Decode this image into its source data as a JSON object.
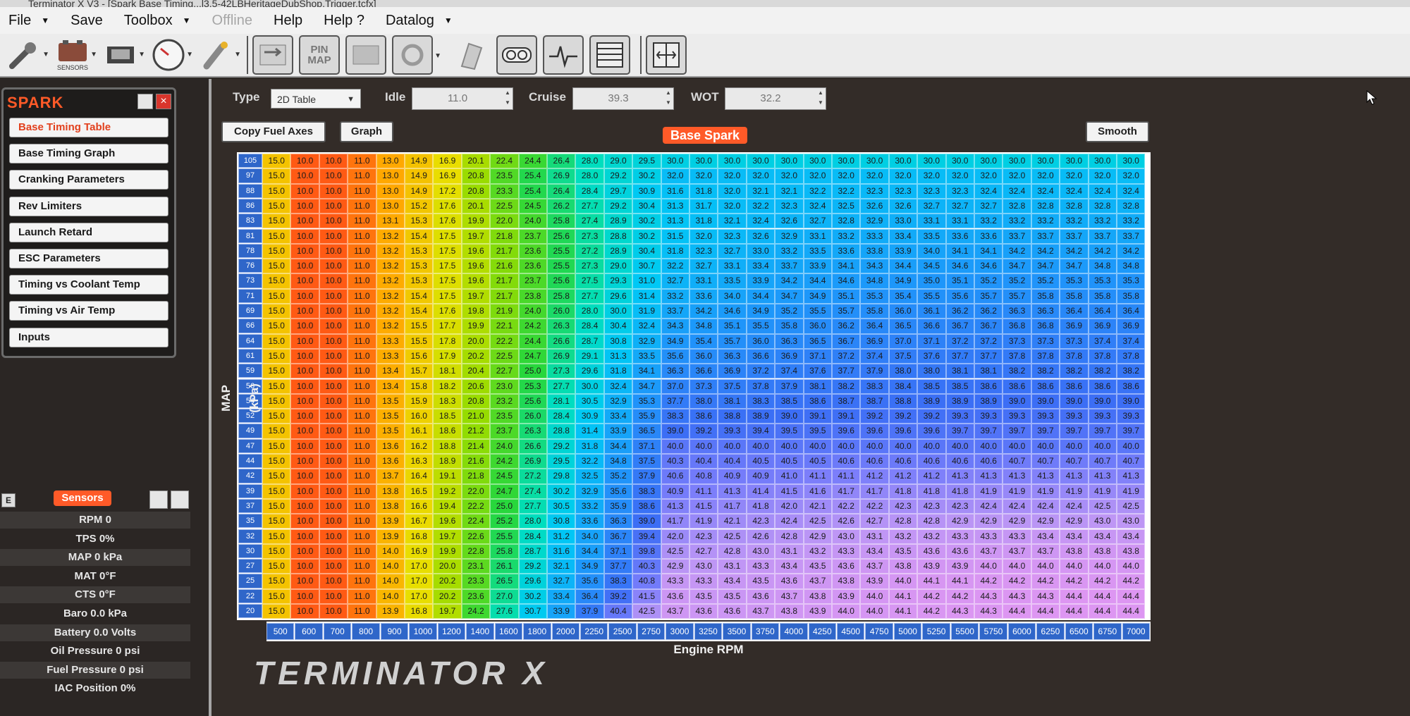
{
  "window": {
    "title": "Terminator X V3 - [Spark Base Timing...l3.5-42LBHeritageDubShop.Trigger.tcfx]"
  },
  "menu": [
    {
      "label": "File",
      "caret": true,
      "disabled": false
    },
    {
      "label": "Save",
      "caret": false,
      "disabled": false
    },
    {
      "label": "Toolbox",
      "caret": true,
      "disabled": false
    },
    {
      "label": "Offline",
      "caret": false,
      "disabled": true
    },
    {
      "label": "Help",
      "caret": false,
      "disabled": false
    },
    {
      "label": "Help ?",
      "caret": false,
      "disabled": false
    },
    {
      "label": "Datalog",
      "caret": true,
      "disabled": false
    }
  ],
  "toolbar": {
    "sensors_label": "SENSORS",
    "pinmap_line1": "PIN",
    "pinmap_line2": "MAP"
  },
  "spark_panel": {
    "title": "SPARK",
    "close_glyph": "×",
    "items": [
      {
        "label": "Base Timing Table",
        "active": true
      },
      {
        "label": "Base Timing Graph",
        "active": false
      },
      {
        "label": "Cranking Parameters",
        "active": false
      },
      {
        "label": "Rev Limiters",
        "active": false
      },
      {
        "label": "Launch Retard",
        "active": false
      },
      {
        "label": "ESC Parameters",
        "active": false
      },
      {
        "label": "Timing vs Coolant Temp",
        "active": false
      },
      {
        "label": "Timing vs Air Temp",
        "active": false
      },
      {
        "label": "Inputs",
        "active": false
      }
    ]
  },
  "sensors": {
    "e_label": "E",
    "title": "Sensors",
    "rows": [
      "RPM 0",
      "TPS 0%",
      "MAP 0 kPa",
      "MAT 0°F",
      "CTS 0°F",
      "Baro 0.0 kPa",
      "Battery 0.0 Volts",
      "Oil Pressure 0 psi",
      "Fuel Pressure 0 psi",
      "IAC Position 0%"
    ]
  },
  "controls": {
    "type_label": "Type",
    "type_value": "2D Table",
    "idle_label": "Idle",
    "idle_value": "11.0",
    "cruise_label": "Cruise",
    "cruise_value": "39.3",
    "wot_label": "WOT",
    "wot_value": "32.2",
    "copy_fuel_axes": "Copy Fuel Axes",
    "graph": "Graph",
    "smooth": "Smooth",
    "table_title": "Base Spark"
  },
  "axes": {
    "x_title": "Engine RPM",
    "y_title": "MAP (kPa)"
  },
  "logo_text": "TERMINATOR X",
  "colors": {
    "accent": "#ff5a28",
    "axis_cell": "#2f66c9"
  },
  "table": {
    "rpm": [
      500,
      600,
      700,
      800,
      900,
      1000,
      1200,
      1400,
      1600,
      1800,
      2000,
      2250,
      2500,
      2750,
      3000,
      3250,
      3500,
      3750,
      4000,
      4250,
      4500,
      4750,
      5000,
      5250,
      5500,
      5750,
      6000,
      6250,
      6500,
      6750,
      7000
    ],
    "map": [
      105,
      97,
      88,
      86,
      83,
      81,
      78,
      76,
      73,
      71,
      69,
      66,
      64,
      61,
      59,
      56,
      54,
      52,
      49,
      47,
      44,
      42,
      39,
      37,
      35,
      32,
      30,
      27,
      25,
      22,
      20
    ],
    "rows": [
      [
        "15.0",
        "10.0",
        "10.0",
        "11.0",
        "13.0",
        "14.9",
        "16.9",
        "20.1",
        "22.4",
        "24.4",
        "26.4",
        "28.0",
        "29.0",
        "29.5",
        "30.0",
        "30.0",
        "30.0",
        "30.0",
        "30.0",
        "30.0",
        "30.0",
        "30.0",
        "30.0",
        "30.0",
        "30.0",
        "30.0",
        "30.0",
        "30.0",
        "30.0",
        "30.0",
        "30.0"
      ],
      [
        "15.0",
        "10.0",
        "10.0",
        "11.0",
        "13.0",
        "14.9",
        "16.9",
        "20.8",
        "23.5",
        "25.4",
        "26.9",
        "28.0",
        "29.2",
        "30.2",
        "32.0",
        "32.0",
        "32.0",
        "32.0",
        "32.0",
        "32.0",
        "32.0",
        "32.0",
        "32.0",
        "32.0",
        "32.0",
        "32.0",
        "32.0",
        "32.0",
        "32.0",
        "32.0",
        "32.0"
      ],
      [
        "15.0",
        "10.0",
        "10.0",
        "11.0",
        "13.0",
        "14.9",
        "17.2",
        "20.8",
        "23.3",
        "25.4",
        "26.4",
        "28.4",
        "29.7",
        "30.9",
        "31.6",
        "31.8",
        "32.0",
        "32.1",
        "32.1",
        "32.2",
        "32.2",
        "32.3",
        "32.3",
        "32.3",
        "32.3",
        "32.4",
        "32.4",
        "32.4",
        "32.4",
        "32.4",
        "32.4"
      ],
      [
        "15.0",
        "10.0",
        "10.0",
        "11.0",
        "13.0",
        "15.2",
        "17.6",
        "20.1",
        "22.5",
        "24.5",
        "26.2",
        "27.7",
        "29.2",
        "30.4",
        "31.3",
        "31.7",
        "32.0",
        "32.2",
        "32.3",
        "32.4",
        "32.5",
        "32.6",
        "32.6",
        "32.7",
        "32.7",
        "32.7",
        "32.8",
        "32.8",
        "32.8",
        "32.8",
        "32.8"
      ],
      [
        "15.0",
        "10.0",
        "10.0",
        "11.0",
        "13.1",
        "15.3",
        "17.6",
        "19.9",
        "22.0",
        "24.0",
        "25.8",
        "27.4",
        "28.9",
        "30.2",
        "31.3",
        "31.8",
        "32.1",
        "32.4",
        "32.6",
        "32.7",
        "32.8",
        "32.9",
        "33.0",
        "33.1",
        "33.1",
        "33.2",
        "33.2",
        "33.2",
        "33.2",
        "33.2",
        "33.2"
      ],
      [
        "15.0",
        "10.0",
        "10.0",
        "11.0",
        "13.2",
        "15.4",
        "17.5",
        "19.7",
        "21.8",
        "23.7",
        "25.6",
        "27.3",
        "28.8",
        "30.2",
        "31.5",
        "32.0",
        "32.3",
        "32.6",
        "32.9",
        "33.1",
        "33.2",
        "33.3",
        "33.4",
        "33.5",
        "33.6",
        "33.6",
        "33.7",
        "33.7",
        "33.7",
        "33.7",
        "33.7"
      ],
      [
        "15.0",
        "10.0",
        "10.0",
        "11.0",
        "13.2",
        "15.3",
        "17.5",
        "19.6",
        "21.7",
        "23.6",
        "25.5",
        "27.2",
        "28.9",
        "30.4",
        "31.8",
        "32.3",
        "32.7",
        "33.0",
        "33.2",
        "33.5",
        "33.6",
        "33.8",
        "33.9",
        "34.0",
        "34.1",
        "34.1",
        "34.2",
        "34.2",
        "34.2",
        "34.2",
        "34.2"
      ],
      [
        "15.0",
        "10.0",
        "10.0",
        "11.0",
        "13.2",
        "15.3",
        "17.5",
        "19.6",
        "21.6",
        "23.6",
        "25.5",
        "27.3",
        "29.0",
        "30.7",
        "32.2",
        "32.7",
        "33.1",
        "33.4",
        "33.7",
        "33.9",
        "34.1",
        "34.3",
        "34.4",
        "34.5",
        "34.6",
        "34.6",
        "34.7",
        "34.7",
        "34.7",
        "34.8",
        "34.8"
      ],
      [
        "15.0",
        "10.0",
        "10.0",
        "11.0",
        "13.2",
        "15.3",
        "17.5",
        "19.6",
        "21.7",
        "23.7",
        "25.6",
        "27.5",
        "29.3",
        "31.0",
        "32.7",
        "33.1",
        "33.5",
        "33.9",
        "34.2",
        "34.4",
        "34.6",
        "34.8",
        "34.9",
        "35.0",
        "35.1",
        "35.2",
        "35.2",
        "35.2",
        "35.3",
        "35.3",
        "35.3"
      ],
      [
        "15.0",
        "10.0",
        "10.0",
        "11.0",
        "13.2",
        "15.4",
        "17.5",
        "19.7",
        "21.7",
        "23.8",
        "25.8",
        "27.7",
        "29.6",
        "31.4",
        "33.2",
        "33.6",
        "34.0",
        "34.4",
        "34.7",
        "34.9",
        "35.1",
        "35.3",
        "35.4",
        "35.5",
        "35.6",
        "35.7",
        "35.7",
        "35.8",
        "35.8",
        "35.8",
        "35.8"
      ],
      [
        "15.0",
        "10.0",
        "10.0",
        "11.0",
        "13.2",
        "15.4",
        "17.6",
        "19.8",
        "21.9",
        "24.0",
        "26.0",
        "28.0",
        "30.0",
        "31.9",
        "33.7",
        "34.2",
        "34.6",
        "34.9",
        "35.2",
        "35.5",
        "35.7",
        "35.8",
        "36.0",
        "36.1",
        "36.2",
        "36.2",
        "36.3",
        "36.3",
        "36.4",
        "36.4",
        "36.4"
      ],
      [
        "15.0",
        "10.0",
        "10.0",
        "11.0",
        "13.2",
        "15.5",
        "17.7",
        "19.9",
        "22.1",
        "24.2",
        "26.3",
        "28.4",
        "30.4",
        "32.4",
        "34.3",
        "34.8",
        "35.1",
        "35.5",
        "35.8",
        "36.0",
        "36.2",
        "36.4",
        "36.5",
        "36.6",
        "36.7",
        "36.7",
        "36.8",
        "36.8",
        "36.9",
        "36.9",
        "36.9"
      ],
      [
        "15.0",
        "10.0",
        "10.0",
        "11.0",
        "13.3",
        "15.5",
        "17.8",
        "20.0",
        "22.2",
        "24.4",
        "26.6",
        "28.7",
        "30.8",
        "32.9",
        "34.9",
        "35.4",
        "35.7",
        "36.0",
        "36.3",
        "36.5",
        "36.7",
        "36.9",
        "37.0",
        "37.1",
        "37.2",
        "37.2",
        "37.3",
        "37.3",
        "37.3",
        "37.4",
        "37.4"
      ],
      [
        "15.0",
        "10.0",
        "10.0",
        "11.0",
        "13.3",
        "15.6",
        "17.9",
        "20.2",
        "22.5",
        "24.7",
        "26.9",
        "29.1",
        "31.3",
        "33.5",
        "35.6",
        "36.0",
        "36.3",
        "36.6",
        "36.9",
        "37.1",
        "37.2",
        "37.4",
        "37.5",
        "37.6",
        "37.7",
        "37.7",
        "37.8",
        "37.8",
        "37.8",
        "37.8",
        "37.8"
      ],
      [
        "15.0",
        "10.0",
        "10.0",
        "11.0",
        "13.4",
        "15.7",
        "18.1",
        "20.4",
        "22.7",
        "25.0",
        "27.3",
        "29.6",
        "31.8",
        "34.1",
        "36.3",
        "36.6",
        "36.9",
        "37.2",
        "37.4",
        "37.6",
        "37.7",
        "37.9",
        "38.0",
        "38.0",
        "38.1",
        "38.1",
        "38.2",
        "38.2",
        "38.2",
        "38.2",
        "38.2"
      ],
      [
        "15.0",
        "10.0",
        "10.0",
        "11.0",
        "13.4",
        "15.8",
        "18.2",
        "20.6",
        "23.0",
        "25.3",
        "27.7",
        "30.0",
        "32.4",
        "34.7",
        "37.0",
        "37.3",
        "37.5",
        "37.8",
        "37.9",
        "38.1",
        "38.2",
        "38.3",
        "38.4",
        "38.5",
        "38.5",
        "38.6",
        "38.6",
        "38.6",
        "38.6",
        "38.6",
        "38.6"
      ],
      [
        "15.0",
        "10.0",
        "10.0",
        "11.0",
        "13.5",
        "15.9",
        "18.3",
        "20.8",
        "23.2",
        "25.6",
        "28.1",
        "30.5",
        "32.9",
        "35.3",
        "37.7",
        "38.0",
        "38.1",
        "38.3",
        "38.5",
        "38.6",
        "38.7",
        "38.7",
        "38.8",
        "38.9",
        "38.9",
        "38.9",
        "39.0",
        "39.0",
        "39.0",
        "39.0",
        "39.0"
      ],
      [
        "15.0",
        "10.0",
        "10.0",
        "11.0",
        "13.5",
        "16.0",
        "18.5",
        "21.0",
        "23.5",
        "26.0",
        "28.4",
        "30.9",
        "33.4",
        "35.9",
        "38.3",
        "38.6",
        "38.8",
        "38.9",
        "39.0",
        "39.1",
        "39.1",
        "39.2",
        "39.2",
        "39.2",
        "39.3",
        "39.3",
        "39.3",
        "39.3",
        "39.3",
        "39.3",
        "39.3"
      ],
      [
        "15.0",
        "10.0",
        "10.0",
        "11.0",
        "13.5",
        "16.1",
        "18.6",
        "21.2",
        "23.7",
        "26.3",
        "28.8",
        "31.4",
        "33.9",
        "36.5",
        "39.0",
        "39.2",
        "39.3",
        "39.4",
        "39.5",
        "39.5",
        "39.6",
        "39.6",
        "39.6",
        "39.6",
        "39.7",
        "39.7",
        "39.7",
        "39.7",
        "39.7",
        "39.7",
        "39.7"
      ],
      [
        "15.0",
        "10.0",
        "10.0",
        "11.0",
        "13.6",
        "16.2",
        "18.8",
        "21.4",
        "24.0",
        "26.6",
        "29.2",
        "31.8",
        "34.4",
        "37.1",
        "40.0",
        "40.0",
        "40.0",
        "40.0",
        "40.0",
        "40.0",
        "40.0",
        "40.0",
        "40.0",
        "40.0",
        "40.0",
        "40.0",
        "40.0",
        "40.0",
        "40.0",
        "40.0",
        "40.0"
      ],
      [
        "15.0",
        "10.0",
        "10.0",
        "11.0",
        "13.6",
        "16.3",
        "18.9",
        "21.6",
        "24.2",
        "26.9",
        "29.5",
        "32.2",
        "34.8",
        "37.5",
        "40.3",
        "40.4",
        "40.4",
        "40.5",
        "40.5",
        "40.5",
        "40.6",
        "40.6",
        "40.6",
        "40.6",
        "40.6",
        "40.6",
        "40.7",
        "40.7",
        "40.7",
        "40.7",
        "40.7"
      ],
      [
        "15.0",
        "10.0",
        "10.0",
        "11.0",
        "13.7",
        "16.4",
        "19.1",
        "21.8",
        "24.5",
        "27.2",
        "29.8",
        "32.5",
        "35.2",
        "37.9",
        "40.6",
        "40.8",
        "40.9",
        "40.9",
        "41.0",
        "41.1",
        "41.1",
        "41.2",
        "41.2",
        "41.2",
        "41.3",
        "41.3",
        "41.3",
        "41.3",
        "41.3",
        "41.3",
        "41.3"
      ],
      [
        "15.0",
        "10.0",
        "10.0",
        "11.0",
        "13.8",
        "16.5",
        "19.2",
        "22.0",
        "24.7",
        "27.4",
        "30.2",
        "32.9",
        "35.6",
        "38.3",
        "40.9",
        "41.1",
        "41.3",
        "41.4",
        "41.5",
        "41.6",
        "41.7",
        "41.7",
        "41.8",
        "41.8",
        "41.8",
        "41.9",
        "41.9",
        "41.9",
        "41.9",
        "41.9",
        "41.9"
      ],
      [
        "15.0",
        "10.0",
        "10.0",
        "11.0",
        "13.8",
        "16.6",
        "19.4",
        "22.2",
        "25.0",
        "27.7",
        "30.5",
        "33.2",
        "35.9",
        "38.6",
        "41.3",
        "41.5",
        "41.7",
        "41.8",
        "42.0",
        "42.1",
        "42.2",
        "42.2",
        "42.3",
        "42.3",
        "42.3",
        "42.4",
        "42.4",
        "42.4",
        "42.4",
        "42.5",
        "42.5"
      ],
      [
        "15.0",
        "10.0",
        "10.0",
        "11.0",
        "13.9",
        "16.7",
        "19.6",
        "22.4",
        "25.2",
        "28.0",
        "30.8",
        "33.6",
        "36.3",
        "39.0",
        "41.7",
        "41.9",
        "42.1",
        "42.3",
        "42.4",
        "42.5",
        "42.6",
        "42.7",
        "42.8",
        "42.8",
        "42.9",
        "42.9",
        "42.9",
        "42.9",
        "42.9",
        "43.0",
        "43.0"
      ],
      [
        "15.0",
        "10.0",
        "10.0",
        "11.0",
        "13.9",
        "16.8",
        "19.7",
        "22.6",
        "25.5",
        "28.4",
        "31.2",
        "34.0",
        "36.7",
        "39.4",
        "42.0",
        "42.3",
        "42.5",
        "42.6",
        "42.8",
        "42.9",
        "43.0",
        "43.1",
        "43.2",
        "43.2",
        "43.3",
        "43.3",
        "43.3",
        "43.4",
        "43.4",
        "43.4",
        "43.4"
      ],
      [
        "15.0",
        "10.0",
        "10.0",
        "11.0",
        "14.0",
        "16.9",
        "19.9",
        "22.8",
        "25.8",
        "28.7",
        "31.6",
        "34.4",
        "37.1",
        "39.8",
        "42.5",
        "42.7",
        "42.8",
        "43.0",
        "43.1",
        "43.2",
        "43.3",
        "43.4",
        "43.5",
        "43.6",
        "43.6",
        "43.7",
        "43.7",
        "43.7",
        "43.8",
        "43.8",
        "43.8"
      ],
      [
        "15.0",
        "10.0",
        "10.0",
        "11.0",
        "14.0",
        "17.0",
        "20.0",
        "23.1",
        "26.1",
        "29.2",
        "32.1",
        "34.9",
        "37.7",
        "40.3",
        "42.9",
        "43.0",
        "43.1",
        "43.3",
        "43.4",
        "43.5",
        "43.6",
        "43.7",
        "43.8",
        "43.9",
        "43.9",
        "44.0",
        "44.0",
        "44.0",
        "44.0",
        "44.0",
        "44.0"
      ],
      [
        "15.0",
        "10.0",
        "10.0",
        "11.0",
        "14.0",
        "17.0",
        "20.2",
        "23.3",
        "26.5",
        "29.6",
        "32.7",
        "35.6",
        "38.3",
        "40.8",
        "43.3",
        "43.3",
        "43.4",
        "43.5",
        "43.6",
        "43.7",
        "43.8",
        "43.9",
        "44.0",
        "44.1",
        "44.1",
        "44.2",
        "44.2",
        "44.2",
        "44.2",
        "44.2",
        "44.2"
      ],
      [
        "15.0",
        "10.0",
        "10.0",
        "11.0",
        "14.0",
        "17.0",
        "20.2",
        "23.6",
        "27.0",
        "30.2",
        "33.4",
        "36.4",
        "39.2",
        "41.5",
        "43.6",
        "43.5",
        "43.5",
        "43.6",
        "43.7",
        "43.8",
        "43.9",
        "44.0",
        "44.1",
        "44.2",
        "44.2",
        "44.3",
        "44.3",
        "44.3",
        "44.4",
        "44.4",
        "44.4"
      ],
      [
        "15.0",
        "10.0",
        "10.0",
        "11.0",
        "13.9",
        "16.8",
        "19.7",
        "24.2",
        "27.6",
        "30.7",
        "33.9",
        "37.9",
        "40.4",
        "42.5",
        "43.7",
        "43.6",
        "43.6",
        "43.7",
        "43.8",
        "43.9",
        "44.0",
        "44.0",
        "44.1",
        "44.2",
        "44.3",
        "44.3",
        "44.4",
        "44.4",
        "44.4",
        "44.4",
        "44.4"
      ]
    ]
  }
}
